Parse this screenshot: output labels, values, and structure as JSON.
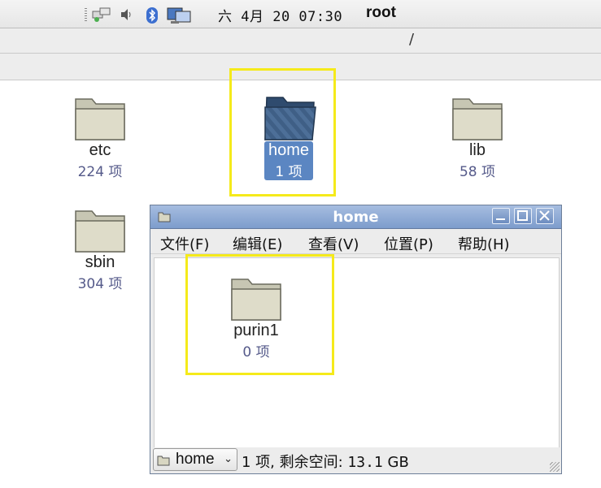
{
  "panel": {
    "clock": "六 4月 20 07:30",
    "user": "root",
    "tray_icons": [
      "network-icon",
      "volume-icon",
      "bluetooth-icon",
      "display-icon"
    ]
  },
  "location": {
    "path": "/"
  },
  "desktop_items": [
    {
      "name": "etc",
      "count": "224 项"
    },
    {
      "name": "home",
      "count": "1 项",
      "selected": true
    },
    {
      "name": "lib",
      "count": "58 项"
    },
    {
      "name": "sbin",
      "count": "304 项"
    }
  ],
  "window": {
    "title": "home",
    "menus": [
      "文件(F)",
      "编辑(E)",
      "查看(V)",
      "位置(P)",
      "帮助(H)"
    ],
    "items": [
      {
        "name": "purin1",
        "count": "0 项"
      }
    ],
    "location_combo": "home",
    "status_prefix": "1 项, 剩余空间: ",
    "status_value": "13.1",
    "status_unit": "GB"
  }
}
